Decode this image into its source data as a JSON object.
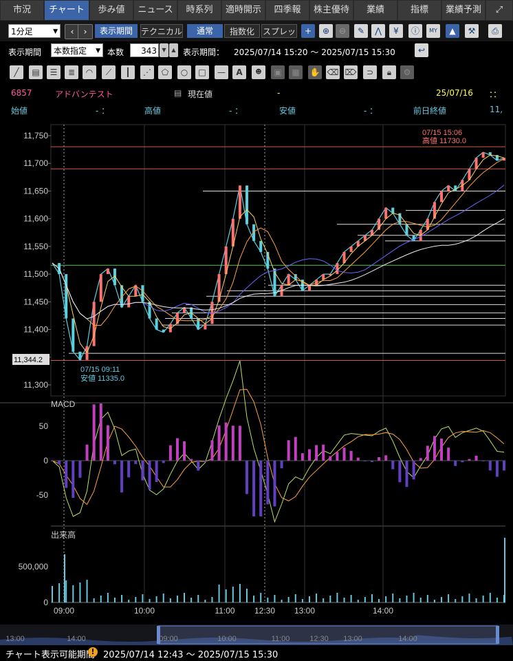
{
  "tabs": [
    "市況",
    "チャート",
    "歩み値",
    "ニュース",
    "時系列",
    "適時開示",
    "四季報",
    "株主優待",
    "業績",
    "指標",
    "業績予測"
  ],
  "active_tab": "チャート",
  "toolbar": {
    "interval": "1分足",
    "period_btn": "表示期間",
    "technical_btn": "テクニカル",
    "normal_btn": "通常",
    "index_btn": "指数化",
    "spread_btn": "スプレッド"
  },
  "range": {
    "label": "表示期間",
    "mode": "本数指定",
    "count_label": "本数",
    "count": "343",
    "period_label": "表示期間：",
    "period_value": "2025/07/14 15:20 ～ 2025/07/15 15:30"
  },
  "stock": {
    "code": "6857",
    "name": "アドバンテスト",
    "now_label": "現在値",
    "now_value": "-",
    "date": "25/07/16",
    "time": "：：",
    "open_label": "始値",
    "open_value": "- ：",
    "high_label": "高値",
    "high_value": "- ：",
    "low_label": "安値",
    "low_value": "- ：",
    "prev_label": "前日終値",
    "prev_value": "11,"
  },
  "chart_data": {
    "type": "line",
    "y_ticks": [
      "11,750",
      "11,700",
      "11,650",
      "11,600",
      "11,550",
      "11,500",
      "11,450",
      "11,400",
      "11,350",
      "11,300"
    ],
    "ylim": [
      11300,
      11750
    ],
    "x_ticks": [
      "09:00",
      "10:00",
      "11:00",
      "12:30",
      "13:00",
      "14:00"
    ],
    "series": [
      {
        "values": [
          11520,
          11500,
          11420,
          11360,
          11345,
          11370,
          11450,
          11500,
          11510,
          11480,
          11440,
          11460,
          11480,
          11450,
          11420,
          11400,
          11395,
          11410,
          11430,
          11440,
          11420,
          11400,
          11410,
          11450,
          11500,
          11550,
          11600,
          11660,
          11590,
          11560,
          11540,
          11510,
          11460,
          11480,
          11500,
          11490,
          11470,
          11480,
          11490,
          11500,
          11500,
          11520,
          11540,
          11550,
          11560,
          11570,
          11580,
          11600,
          11620,
          11610,
          11590,
          11570,
          11560,
          11580,
          11600,
          11630,
          11650,
          11660,
          11650,
          11670,
          11690,
          11710,
          11720,
          11715,
          11705,
          11710
        ]
      }
    ],
    "high_marker": {
      "time": "07/15 15:06",
      "label": "高値 11730.0"
    },
    "low_marker": {
      "time": "07/15 09:11",
      "label": "安値 11335.0"
    },
    "price_badge": "11,344.2",
    "macd": {
      "title": "MACD",
      "ticks": [
        "50",
        "0",
        "-50"
      ],
      "ylim": [
        -70,
        70
      ]
    },
    "volume": {
      "title": "出来高",
      "ticks": [
        "500,000",
        "0"
      ],
      "ylim": [
        0,
        600000
      ]
    }
  },
  "scroll": {
    "ticks": [
      "13:00",
      "14:00",
      "09:00",
      "10:00",
      "11:00",
      "12:30",
      "13:00",
      "14:00"
    ]
  },
  "status": {
    "label": "チャート表示可能期間",
    "value": "2025/07/14 12:43 ～ 2025/07/15 15:30"
  },
  "colors": {
    "accent": "#3c64a8",
    "pink": "#ff5aa0",
    "cyan": "#63c8e0",
    "yellow": "#ffff44",
    "candle_up": "#ff7070",
    "candle_down": "#5ad0e0"
  }
}
